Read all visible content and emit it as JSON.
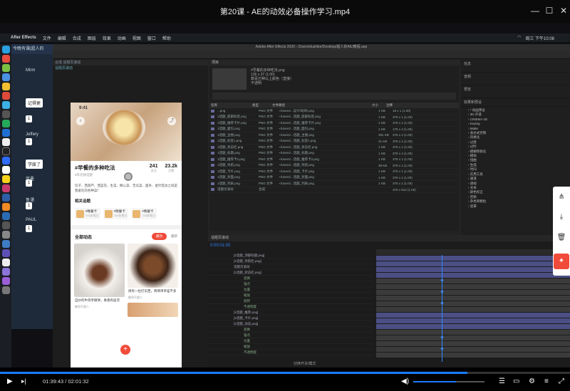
{
  "player": {
    "title": "第20课 - AE的动效必备操作学习.mp4",
    "time_current": "01:39:43",
    "time_total": "02:01:32",
    "progress": 0.82,
    "volume": 0.6,
    "accent": "#1a7cff"
  },
  "mac": {
    "app_name": "After Effects",
    "menus": [
      "文件",
      "编辑",
      "合成",
      "图层",
      "效果",
      "动画",
      "视图",
      "窗口",
      "帮助"
    ],
    "clock": "周三 下午10:08"
  },
  "chat": {
    "title": "今晚有课|超人的",
    "contacts": [
      "Mirm",
      "Jeffery",
      "蓝墨",
      "鲁漂",
      "PAUL"
    ],
    "bubbles": [
      "记得更",
      "1",
      "1",
      "学废了",
      "1",
      "1",
      "1"
    ]
  },
  "ae": {
    "window_title": "Adobe After Effects 2020 - /Users/dushike/Desktop/超人的AE/教程.aep",
    "comp_tab": "合成 话题页滚动",
    "comp_sub": "话题页滚动",
    "project_tab": "项目",
    "project_info": [
      "#早餐的多种吃法.png",
      "136 x 37 (1.00)",
      "数百万种以上颜色（直接）",
      "不透明"
    ],
    "columns": [
      "名称",
      "类型",
      "文件路径",
      "大小",
      "注释"
    ],
    "files": [
      {
        "name": "...png",
        "type": "PNG 文件",
        "path": "~/Users/...设计/动效/.png",
        "size": "1 KB",
        "dim": "19 x 1 (1.00)"
      },
      {
        "name": "1话题_底部标签.png",
        "type": "PNG 文件",
        "path": "~/Users/...话题_底部标签.png",
        "size": "1 KB",
        "dim": "375 x 1 (1.00)"
      },
      {
        "name": "1话题_推荐卡片.png",
        "type": "PNG 文件",
        "path": "~/Users/...话题_推荐卡片.png",
        "size": "1 KB",
        "dim": "375 x 1 (1.00)"
      },
      {
        "name": "1话题_面包.png",
        "type": "PNG 文件",
        "path": "~/Users/...话题_面包.png",
        "size": "1 KB",
        "dim": "175 x 4 (1.00)"
      },
      {
        "name": "1话题_主图.png",
        "type": "PNG 文件",
        "path": "~/Users/...话题_主图.png",
        "size": "391 KB",
        "dim": "375 x 2 (1.00)"
      },
      {
        "name": "1话题_标签1.png",
        "type": "PNG 文件",
        "path": "~/Users/...话题_标签1.png",
        "size": "21 KB",
        "dim": "375 x 1 (1.00)"
      },
      {
        "name": "1话题_状态栏.png",
        "type": "PNG 文件",
        "path": "~/Users/...话题_状态栏.png",
        "size": "1 KB",
        "dim": "375 x 1 (1.00)"
      },
      {
        "name": "1话题_标题.png",
        "type": "PNG 文件",
        "path": "~/Users/...话题_标题.png",
        "size": "1 KB",
        "dim": "375 x 4 (1.00)"
      },
      {
        "name": "1话题_推荐卡2.png",
        "type": "PNG 文件",
        "path": "~/Users/...话题_推荐卡2.png",
        "size": "1 KB",
        "dim": "375 x 1 (1.00)"
      },
      {
        "name": "1话题_导航.png",
        "type": "PNG 文件",
        "path": "~/Users/...话题_导航.png",
        "size": "38 KB",
        "dim": "375 x 1 (1.00)"
      },
      {
        "name": "1话题_卡片.png",
        "type": "PNG 文件",
        "path": "~/Users/...话题_卡片.png",
        "size": "1 KB",
        "dim": "375 x 1 (1.00)"
      },
      {
        "name": "1话题_封面.png",
        "type": "PNG 文件",
        "path": "~/Users/...话题_封面.png",
        "size": "1 KB",
        "dim": "375 x 1 (1.00)"
      },
      {
        "name": "1话题_列表.png",
        "type": "PNG 文件",
        "path": "~/Users/...话题_列表.png",
        "size": "1 KB",
        "dim": "375 x 1 (1.00)"
      },
      {
        "name": "话题页滚动",
        "type": "合成",
        "path": "",
        "size": "",
        "dim": "375 x 812 (1.00)"
      }
    ],
    "right_sections": [
      "信息",
      "音频",
      "预览",
      "效果和预设"
    ],
    "effects_tree": [
      "* 动画预设",
      "3D 声道",
      "CINEMA 4D",
      "Keying",
      "Matte",
      "表达式控制",
      "风格化",
      "过渡",
      "过时",
      "模糊和锐化",
      "模拟",
      "扭曲",
      "生成",
      "时间",
      "实用工具",
      "通道",
      "透视",
      "文本",
      "颜色校正",
      "音频",
      "杂色和颗粒",
      "遮罩"
    ],
    "timeline_tab": "话题页滚动",
    "timeline_time": "0:00:01:00",
    "layers": [
      {
        "name": "[1话题_顶部标题.png]",
        "sub": false
      },
      {
        "name": "[1话题_导航栏.png]",
        "sub": false
      },
      {
        "name": "话题页滚动",
        "sub": false
      },
      {
        "name": "[1话题_状态栏.png]",
        "sub": false
      },
      {
        "name": "变换",
        "sub": true
      },
      {
        "name": "锚点",
        "sub": true
      },
      {
        "name": "位置",
        "sub": true
      },
      {
        "name": "缩放",
        "sub": true
      },
      {
        "name": "旋转",
        "sub": true
      },
      {
        "name": "不透明度",
        "sub": true
      },
      {
        "name": "[1话题_推荐.png]",
        "sub": false
      },
      {
        "name": "[1话题_卡片.png]",
        "sub": false
      },
      {
        "name": "[1话题_动态.png]",
        "sub": false
      },
      {
        "name": "变换",
        "sub": true
      },
      {
        "name": "锚点",
        "sub": true
      },
      {
        "name": "位置",
        "sub": true
      },
      {
        "name": "缩放",
        "sub": true
      },
      {
        "name": "不透明度",
        "sub": true
      }
    ],
    "bottom_bar": "切换开关/模式"
  },
  "phone": {
    "time": "9:41",
    "title": "#早餐的多种吃法",
    "subtitle": "6年优质话题",
    "stat1_value": "241",
    "stat1_label": "关注",
    "stat2_value": "23.2k",
    "stat2_label": "点赞",
    "description": "饺子、西葫芦、西蓝花、生菜、椰心菜、苦瓜菜、面条、金针菇总之就是我爱吃的各种菜！",
    "related_title": "相关话题",
    "related": [
      {
        "name": "#晚餐卡",
        "count": "234条笔记"
      },
      {
        "name": "#晚餐卡",
        "count": "234条笔记"
      },
      {
        "name": "#晚餐卡",
        "count": "234条笔记"
      }
    ],
    "all_title": "全部动态",
    "hot": "最热",
    "new": "最新",
    "post1_caption": "自炒的牛肉手撕饼，真香有层次",
    "post1_user": "御哥不超人",
    "post2_caption": "周有一拉打东西，简简单单差不多",
    "post2_user": "御哥不超人"
  }
}
